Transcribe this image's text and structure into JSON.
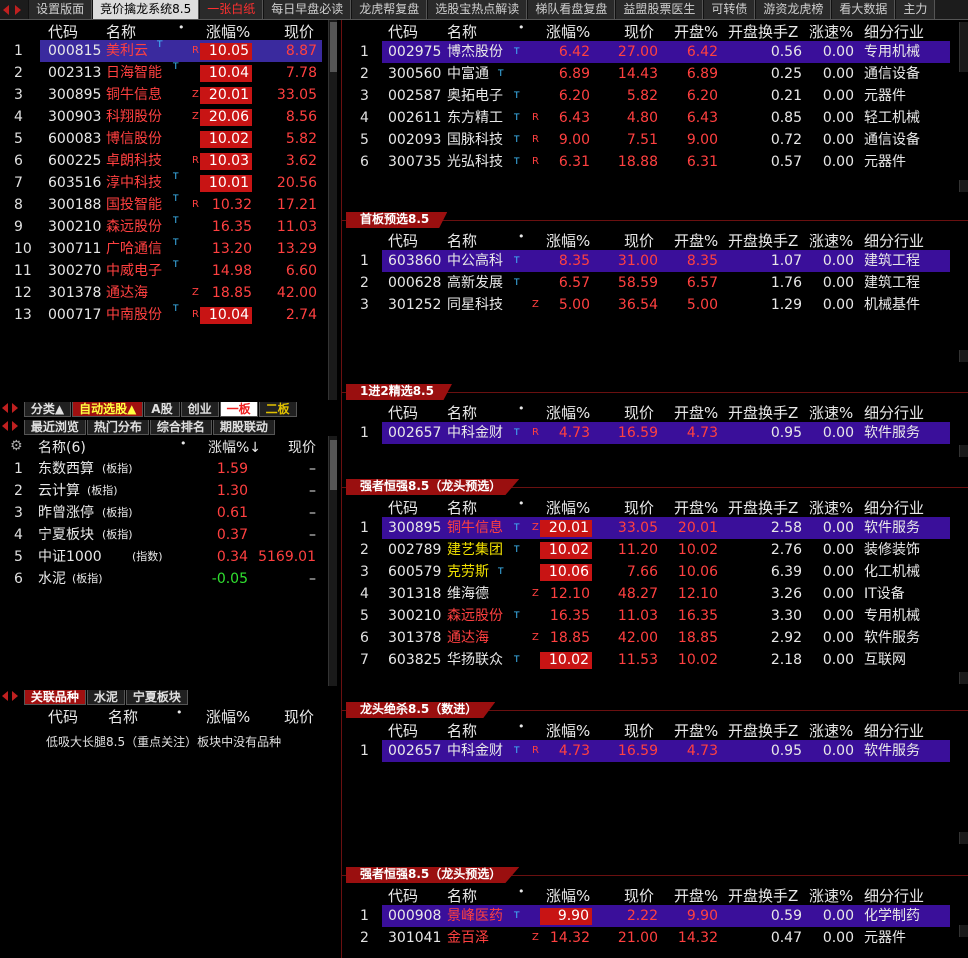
{
  "topbar": {
    "tabs": [
      "设置版面",
      "竞价擒龙系统8.5",
      "一张白纸",
      "每日早盘必读",
      "龙虎帮复盘",
      "选股宝热点解读",
      "梯队看盘复盘",
      "益盟股票医生",
      "可转债",
      "游资龙虎榜",
      "看大数据",
      "主力"
    ]
  },
  "left_top": {
    "headers": [
      "代码",
      "名称",
      "•",
      "涨幅%",
      "现价"
    ],
    "rows": [
      {
        "no": "1",
        "code": "000815",
        "name": "美利云",
        "sup": "T",
        "tag": "R",
        "chg": "10.05",
        "price": "8.87",
        "boxed": true,
        "sel": true
      },
      {
        "no": "2",
        "code": "002313",
        "name": "日海智能",
        "sup": "T",
        "tag": "",
        "chg": "10.04",
        "price": "7.78",
        "boxed": true
      },
      {
        "no": "3",
        "code": "300895",
        "name": "铜牛信息",
        "sup": "",
        "tag": "Z",
        "chg": "20.01",
        "price": "33.05",
        "boxed": true
      },
      {
        "no": "4",
        "code": "300903",
        "name": "科翔股份",
        "sup": "",
        "tag": "Z",
        "chg": "20.06",
        "price": "8.56",
        "boxed": true
      },
      {
        "no": "5",
        "code": "600083",
        "name": "博信股份",
        "sup": "",
        "tag": "",
        "chg": "10.02",
        "price": "5.82",
        "boxed": true
      },
      {
        "no": "6",
        "code": "600225",
        "name": "卓朗科技",
        "sup": "",
        "tag": "R",
        "chg": "10.03",
        "price": "3.62",
        "boxed": true
      },
      {
        "no": "7",
        "code": "603516",
        "name": "淳中科技",
        "sup": "T",
        "tag": "",
        "chg": "10.01",
        "price": "20.56",
        "boxed": true
      },
      {
        "no": "8",
        "code": "300188",
        "name": "国投智能",
        "sup": "T",
        "tag": "R",
        "chg": "10.32",
        "price": "17.21",
        "boxed": false
      },
      {
        "no": "9",
        "code": "300210",
        "name": "森远股份",
        "sup": "T",
        "tag": "",
        "chg": "16.35",
        "price": "11.03",
        "boxed": false
      },
      {
        "no": "10",
        "code": "300711",
        "name": "广哈通信",
        "sup": "T",
        "tag": "",
        "chg": "13.20",
        "price": "13.29",
        "boxed": false
      },
      {
        "no": "11",
        "code": "300270",
        "name": "中威电子",
        "sup": "T",
        "tag": "",
        "chg": "14.98",
        "price": "6.60",
        "boxed": false
      },
      {
        "no": "12",
        "code": "301378",
        "name": "通达海",
        "sup": "",
        "tag": "Z",
        "chg": "18.85",
        "price": "42.00",
        "boxed": false
      },
      {
        "no": "13",
        "code": "000717",
        "name": "中南股份",
        "sup": "T",
        "tag": "R",
        "chg": "10.04",
        "price": "2.74",
        "boxed": true
      }
    ]
  },
  "left_tabs1": [
    "分类▲",
    "自动选股▲",
    "A股",
    "创业",
    "一板",
    "二板"
  ],
  "left_tabs2": [
    "最近浏览",
    "热门分布",
    "综合排名",
    "期股联动"
  ],
  "left_mid": {
    "headers": [
      "名称(6)",
      "•",
      "涨幅%↓",
      "现价"
    ],
    "rows": [
      {
        "no": "1",
        "name": "东数西算",
        "kind": "(板指)",
        "chg": "1.59",
        "price": "–"
      },
      {
        "no": "2",
        "name": "云计算",
        "kind": "(板指)",
        "chg": "1.30",
        "price": "–"
      },
      {
        "no": "3",
        "name": "昨曾涨停",
        "kind": "(板指)",
        "chg": "0.61",
        "price": "–"
      },
      {
        "no": "4",
        "name": "宁夏板块",
        "kind": "(板指)",
        "chg": "0.37",
        "price": "–"
      },
      {
        "no": "5",
        "name": "中证1000",
        "kind": "(指数)",
        "chg": "0.34",
        "price": "5169.01"
      },
      {
        "no": "6",
        "name": "水泥",
        "kind": "(板指)",
        "chg": "-0.05",
        "price": "–"
      }
    ]
  },
  "left_tabs3": [
    "关联品种",
    "水泥",
    "宁夏板块"
  ],
  "left_bot": {
    "headers": [
      "代码",
      "名称",
      "•",
      "涨幅%",
      "现价"
    ],
    "note": "低吸大长腿8.5（重点关注）板块中没有品种"
  },
  "right_headers": [
    "代码",
    "名称",
    "•",
    "涨幅%",
    "现价",
    "开盘%",
    "开盘换手Z",
    "涨速%",
    "细分行业"
  ],
  "sections": [
    {
      "title": "",
      "rows": [
        {
          "no": "1",
          "code": "002975",
          "name": "博杰股份",
          "sup": "T",
          "tag": "",
          "chg": "6.42",
          "price": "27.00",
          "open": "6.42",
          "turn": "0.56",
          "speed": "0.00",
          "ind": "专用机械",
          "sel": true
        },
        {
          "no": "2",
          "code": "300560",
          "name": "中富通",
          "sup": "T",
          "tag": "",
          "chg": "6.89",
          "price": "14.43",
          "open": "6.89",
          "turn": "0.25",
          "speed": "0.00",
          "ind": "通信设备"
        },
        {
          "no": "3",
          "code": "002587",
          "name": "奥拓电子",
          "sup": "T",
          "tag": "",
          "chg": "6.20",
          "price": "5.82",
          "open": "6.20",
          "turn": "0.21",
          "speed": "0.00",
          "ind": "元器件"
        },
        {
          "no": "4",
          "code": "002611",
          "name": "东方精工",
          "sup": "T",
          "tag": "R",
          "chg": "6.43",
          "price": "4.80",
          "open": "6.43",
          "turn": "0.85",
          "speed": "0.00",
          "ind": "轻工机械"
        },
        {
          "no": "5",
          "code": "002093",
          "name": "国脉科技",
          "sup": "T",
          "tag": "R",
          "chg": "9.00",
          "price": "7.51",
          "open": "9.00",
          "turn": "0.72",
          "speed": "0.00",
          "ind": "通信设备"
        },
        {
          "no": "6",
          "code": "300735",
          "name": "光弘科技",
          "sup": "T",
          "tag": "R",
          "chg": "6.31",
          "price": "18.88",
          "open": "6.31",
          "turn": "0.57",
          "speed": "0.00",
          "ind": "元器件"
        }
      ]
    },
    {
      "title": "首板预选8.5",
      "rows": [
        {
          "no": "1",
          "code": "603860",
          "name": "中公高科",
          "sup": "T",
          "tag": "",
          "chg": "8.35",
          "price": "31.00",
          "open": "8.35",
          "turn": "1.07",
          "speed": "0.00",
          "ind": "建筑工程",
          "sel": true
        },
        {
          "no": "2",
          "code": "000628",
          "name": "高新发展",
          "sup": "T",
          "tag": "",
          "chg": "6.57",
          "price": "58.59",
          "open": "6.57",
          "turn": "1.76",
          "speed": "0.00",
          "ind": "建筑工程"
        },
        {
          "no": "3",
          "code": "301252",
          "name": "同星科技",
          "sup": "",
          "tag": "Z",
          "chg": "5.00",
          "price": "36.54",
          "open": "5.00",
          "turn": "1.29",
          "speed": "0.00",
          "ind": "机械基件"
        }
      ]
    },
    {
      "title": "1进2精选8.5",
      "rows": [
        {
          "no": "1",
          "code": "002657",
          "name": "中科金财",
          "sup": "T",
          "tag": "R",
          "chg": "4.73",
          "price": "16.59",
          "open": "4.73",
          "turn": "0.95",
          "speed": "0.00",
          "ind": "软件服务",
          "sel": true
        }
      ]
    },
    {
      "title": "强者恒强8.5（龙头预选）",
      "rows": [
        {
          "no": "1",
          "code": "300895",
          "name": "铜牛信息",
          "sup": "T",
          "tag": "Z",
          "chg": "20.01",
          "price": "33.05",
          "open": "20.01",
          "turn": "2.58",
          "speed": "0.00",
          "ind": "软件服务",
          "sel": true,
          "boxed": true,
          "nc": "r"
        },
        {
          "no": "2",
          "code": "002789",
          "name": "建艺集团",
          "sup": "T",
          "tag": "",
          "chg": "10.02",
          "price": "11.20",
          "open": "10.02",
          "turn": "2.76",
          "speed": "0.00",
          "ind": "装修装饰",
          "boxed": true,
          "nc": "y"
        },
        {
          "no": "3",
          "code": "600579",
          "name": "克劳斯",
          "sup": "T",
          "tag": "",
          "chg": "10.06",
          "price": "7.66",
          "open": "10.06",
          "turn": "6.39",
          "speed": "0.00",
          "ind": "化工机械",
          "boxed": true,
          "nc": "y"
        },
        {
          "no": "4",
          "code": "301318",
          "name": "维海德",
          "sup": "",
          "tag": "Z",
          "chg": "12.10",
          "price": "48.27",
          "open": "12.10",
          "turn": "3.26",
          "speed": "0.00",
          "ind": "IT设备"
        },
        {
          "no": "5",
          "code": "300210",
          "name": "森远股份",
          "sup": "T",
          "tag": "",
          "chg": "16.35",
          "price": "11.03",
          "open": "16.35",
          "turn": "3.30",
          "speed": "0.00",
          "ind": "专用机械",
          "nc": "r"
        },
        {
          "no": "6",
          "code": "301378",
          "name": "通达海",
          "sup": "",
          "tag": "Z",
          "chg": "18.85",
          "price": "42.00",
          "open": "18.85",
          "turn": "2.92",
          "speed": "0.00",
          "ind": "软件服务",
          "nc": "r"
        },
        {
          "no": "7",
          "code": "603825",
          "name": "华扬联众",
          "sup": "T",
          "tag": "",
          "chg": "10.02",
          "price": "11.53",
          "open": "10.02",
          "turn": "2.18",
          "speed": "0.00",
          "ind": "互联网",
          "boxed": true
        }
      ]
    },
    {
      "title": "龙头绝杀8.5（数进）",
      "rows": [
        {
          "no": "1",
          "code": "002657",
          "name": "中科金财",
          "sup": "T",
          "tag": "R",
          "chg": "4.73",
          "price": "16.59",
          "open": "4.73",
          "turn": "0.95",
          "speed": "0.00",
          "ind": "软件服务",
          "sel": true
        }
      ]
    },
    {
      "title": "强者恒强8.5（龙头预选）",
      "rows": [
        {
          "no": "1",
          "code": "000908",
          "name": "景峰医药",
          "sup": "T",
          "tag": "",
          "chg": "9.90",
          "price": "2.22",
          "open": "9.90",
          "turn": "0.59",
          "speed": "0.00",
          "ind": "化学制药",
          "sel": true,
          "boxed": true,
          "nc": "r"
        },
        {
          "no": "2",
          "code": "301041",
          "name": "金百泽",
          "sup": "",
          "tag": "Z",
          "chg": "14.32",
          "price": "21.00",
          "open": "14.32",
          "turn": "0.47",
          "speed": "0.00",
          "ind": "元器件",
          "nc": "r"
        }
      ]
    }
  ]
}
